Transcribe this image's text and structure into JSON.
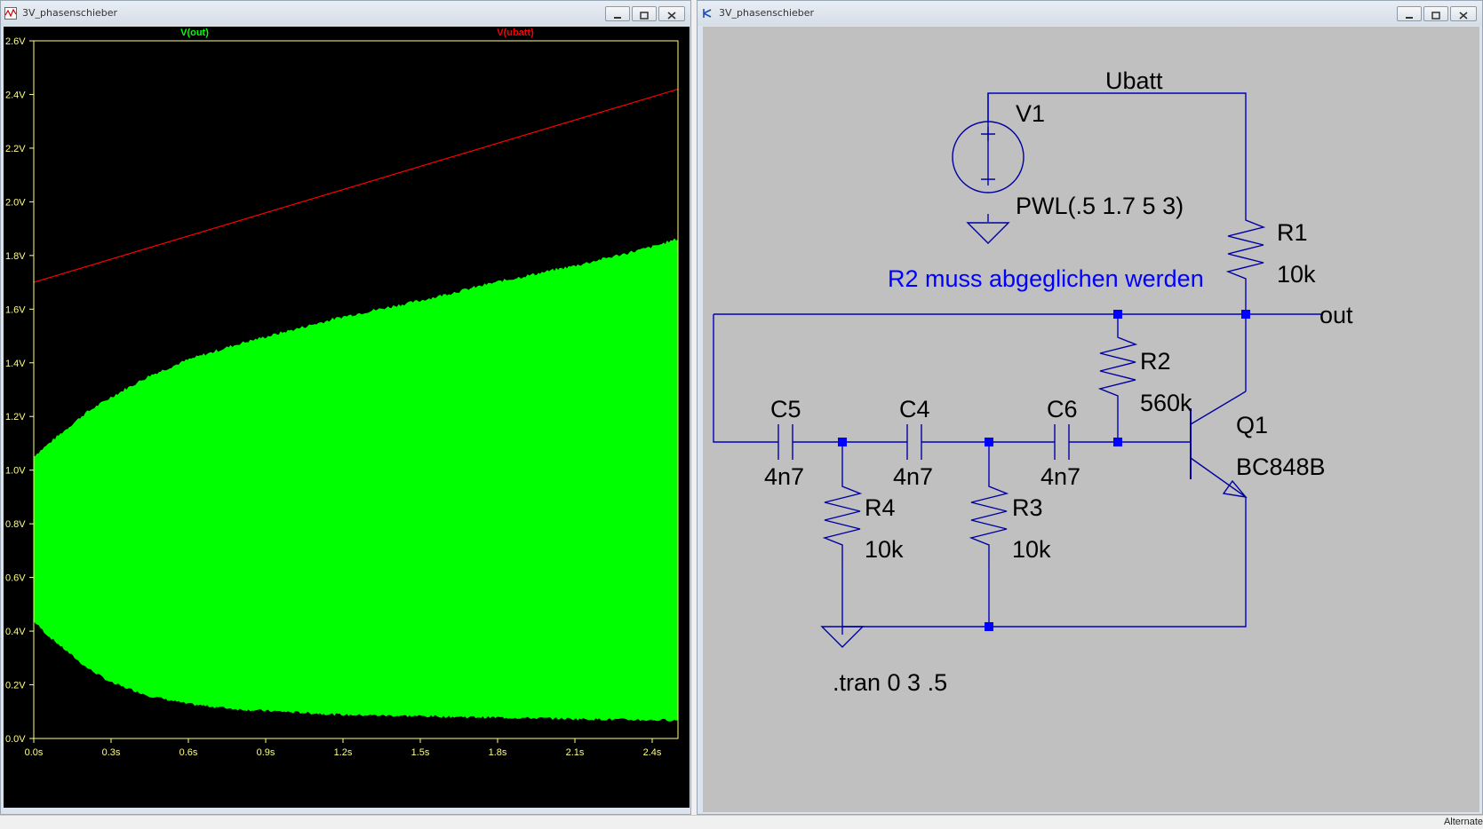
{
  "waveform_window": {
    "title": "3V_phasenschieber",
    "controls": {
      "minimize_icon": "minimize-icon",
      "maximize_icon": "restore-icon",
      "close_icon": "close-icon"
    }
  },
  "schematic_window": {
    "title": "3V_phasenschieber",
    "controls": {
      "minimize_icon": "minimize-icon",
      "maximize_icon": "restore-icon",
      "close_icon": "close-icon"
    }
  },
  "chart_data": {
    "type": "area",
    "title": "",
    "xlabel": "",
    "ylabel": "",
    "xlim": [
      0,
      2.5
    ],
    "ylim": [
      0,
      2.6
    ],
    "x_ticks": [
      0,
      0.3,
      0.6,
      0.9,
      1.2,
      1.5,
      1.8,
      2.1,
      2.4
    ],
    "x_tick_labels": [
      "0.0s",
      "0.3s",
      "0.6s",
      "0.9s",
      "1.2s",
      "1.5s",
      "1.8s",
      "2.1s",
      "2.4s"
    ],
    "y_ticks": [
      0,
      0.2,
      0.4,
      0.6,
      0.8,
      1.0,
      1.2,
      1.4,
      1.6,
      1.8,
      2.0,
      2.2,
      2.4,
      2.6
    ],
    "y_tick_labels": [
      "0.0V",
      "0.2V",
      "0.4V",
      "0.6V",
      "0.8V",
      "1.0V",
      "1.2V",
      "1.4V",
      "1.6V",
      "1.8V",
      "2.0V",
      "2.2V",
      "2.4V",
      "2.6V"
    ],
    "grid": false,
    "legend": "top",
    "series": [
      {
        "name": "V(out)",
        "color": "#00ff00",
        "kind": "envelope",
        "x": [
          0,
          0.05,
          0.1,
          0.2,
          0.3,
          0.45,
          0.6,
          0.8,
          1.0,
          1.2,
          1.5,
          1.8,
          2.1,
          2.4,
          2.5
        ],
        "upper": [
          1.05,
          1.09,
          1.13,
          1.21,
          1.27,
          1.35,
          1.41,
          1.47,
          1.52,
          1.57,
          1.63,
          1.7,
          1.76,
          1.83,
          1.86
        ],
        "lower": [
          0.44,
          0.39,
          0.35,
          0.27,
          0.21,
          0.16,
          0.13,
          0.11,
          0.1,
          0.09,
          0.085,
          0.08,
          0.075,
          0.07,
          0.07
        ]
      },
      {
        "name": "V(ubatt)",
        "color": "#ff0000",
        "kind": "line",
        "x": [
          0,
          2.5
        ],
        "y": [
          1.7,
          2.42
        ]
      }
    ]
  },
  "schematic": {
    "net_label_ubatt": "Ubatt",
    "net_label_out": "out",
    "comment": "R2 muss abgeglichen werden",
    "directive": ".tran 0 3 .5",
    "V1": {
      "name": "V1",
      "value": "PWL(.5 1.7 5 3)"
    },
    "R1": {
      "name": "R1",
      "value": "10k"
    },
    "R2": {
      "name": "R2",
      "value": "560k"
    },
    "R3": {
      "name": "R3",
      "value": "10k"
    },
    "R4": {
      "name": "R4",
      "value": "10k"
    },
    "C4": {
      "name": "C4",
      "value": "4n7"
    },
    "C5": {
      "name": "C5",
      "value": "4n7"
    },
    "C6": {
      "name": "C6",
      "value": "4n7"
    },
    "Q1": {
      "name": "Q1",
      "value": "BC848B"
    },
    "colors": {
      "wire": "#0000c0",
      "component": "#0000a0",
      "text": "#000000",
      "comment": "#0000ff",
      "junction": "#0000ff"
    }
  },
  "statusbar": {
    "text": "Alternate"
  }
}
